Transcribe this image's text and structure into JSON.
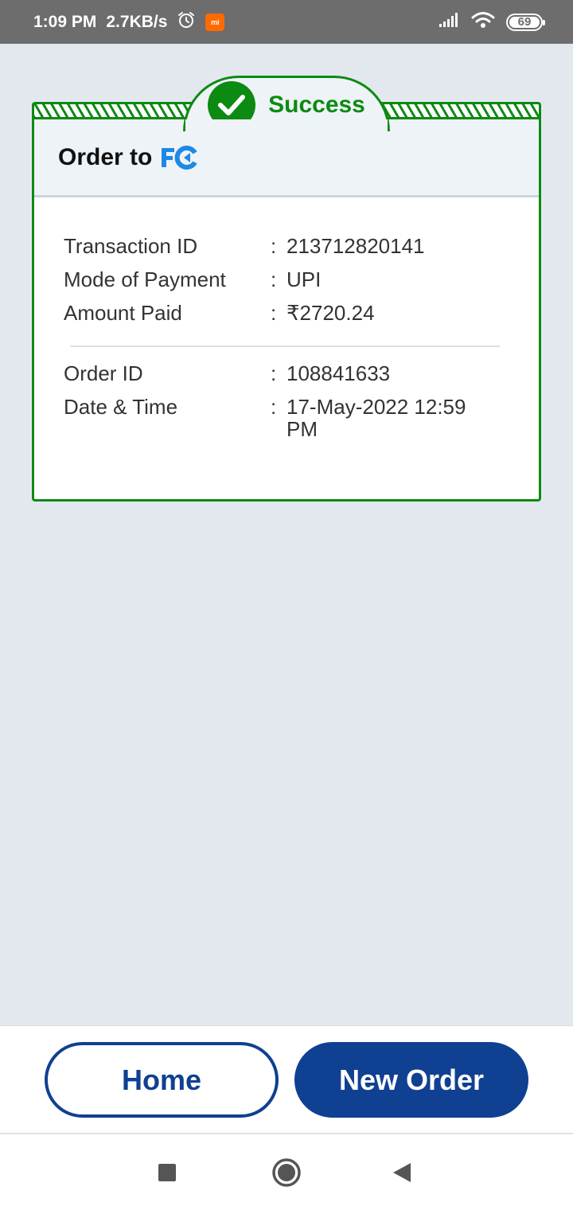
{
  "status_bar": {
    "time": "1:09 PM",
    "speed": "2.7KB/s",
    "mi_badge": "mi",
    "battery": "69",
    "icons": [
      "alarm-icon",
      "signal-icon",
      "wifi-icon",
      "battery-icon"
    ]
  },
  "card": {
    "status": "Success",
    "order_to": "Order to",
    "brand_logo": "FC",
    "rows": [
      {
        "label": "Transaction ID",
        "sep": ":",
        "value": "213712820141"
      },
      {
        "label": "Mode of Payment",
        "sep": ":",
        "value": "UPI"
      },
      {
        "label": "Amount Paid",
        "sep": ":",
        "value": "₹2720.24"
      }
    ],
    "rows2": [
      {
        "label": "Order ID",
        "sep": ":",
        "value": "108841633"
      },
      {
        "label": "Date & Time",
        "sep": ":",
        "value": "17-May-2022 12:59 PM"
      }
    ]
  },
  "actions": {
    "home_label": "Home",
    "new_order_label": "New Order"
  },
  "colors": {
    "success_green": "#0d8a12",
    "primary_blue": "#0f4092",
    "brand_blue": "#1e88e5"
  },
  "nav": [
    "recents-icon",
    "home-icon",
    "back-icon"
  ]
}
